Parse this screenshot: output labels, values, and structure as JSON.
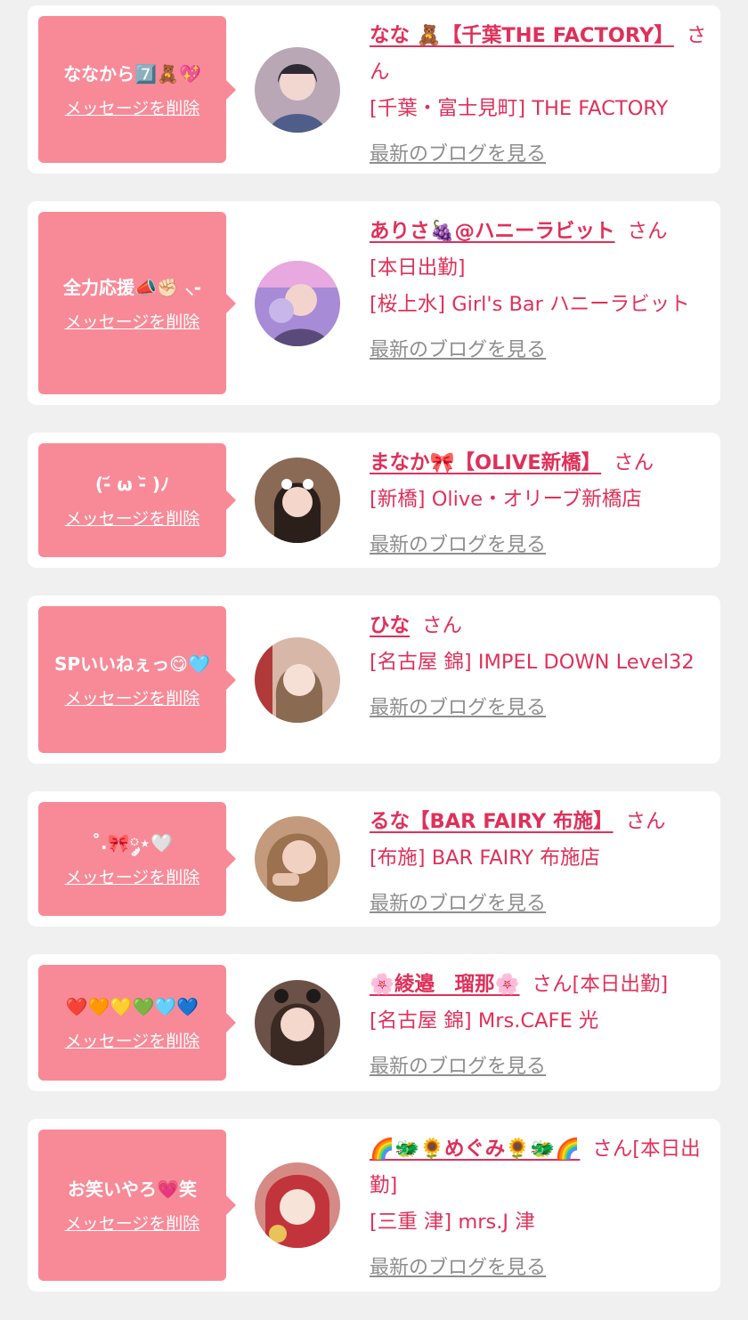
{
  "delete_label": "メッセージを削除",
  "honorific": "さん",
  "blog_label": "最新のブログを見る",
  "colors": {
    "bubble": "#f88a98",
    "link": "#e0305a",
    "muted": "#8e8e8e",
    "background": "#f0f0f0"
  },
  "cards": [
    {
      "message": "ななから7️⃣🧸💖",
      "name": "なな 🧸【千葉THE FACTORY】",
      "status": "",
      "shop": "[千葉・富士見町] THE FACTORY",
      "avatar_icon": "profile-photo-icon",
      "avatar_color": "#b9a7b5"
    },
    {
      "message": "全力応援📣✊🏻 ⸜-",
      "name": "ありさ🍇@ハニーラビット",
      "status": "[本日出勤]",
      "shop": "[桜上水] Girl's Bar ハニーラビット",
      "avatar_icon": "profile-photo-icon",
      "avatar_color": "#a78bd6"
    },
    {
      "message": "(-᷄ ω -᷅ )ﾉ",
      "name": "まなか🎀【OLIVE新橋】",
      "status": "",
      "shop": "[新橋] Olive・オリーブ新橋店",
      "avatar_icon": "profile-photo-icon",
      "avatar_color": "#8a6a55"
    },
    {
      "message": "SPいいねぇっ😋🩵",
      "name": "ひな",
      "status": "",
      "shop": "[名古屋 錦] IMPEL DOWN Level32",
      "avatar_icon": "profile-photo-icon",
      "avatar_color": "#d7b7a7"
    },
    {
      "message": "˚.🎀༘⋆🤍",
      "name": "るな【BAR FAIRY 布施】",
      "status": "",
      "shop": "[布施] BAR FAIRY 布施店",
      "avatar_icon": "profile-photo-icon",
      "avatar_color": "#c39a7c"
    },
    {
      "message": "❤️🧡💛💚🩵💙",
      "name": "🌸綾邉　瑠那🌸",
      "status": "[本日出勤]",
      "shop": "[名古屋 錦] Mrs.CAFE 光",
      "avatar_icon": "profile-photo-icon",
      "avatar_color": "#6b5147"
    },
    {
      "message": "お笑いやろ💗笑",
      "name": "🌈🐲🌻めぐみ🌻🐲🌈",
      "status": "[本日出勤]",
      "shop": "[三重 津] mrs.J 津",
      "avatar_icon": "profile-photo-icon",
      "avatar_color": "#d58a86"
    }
  ]
}
